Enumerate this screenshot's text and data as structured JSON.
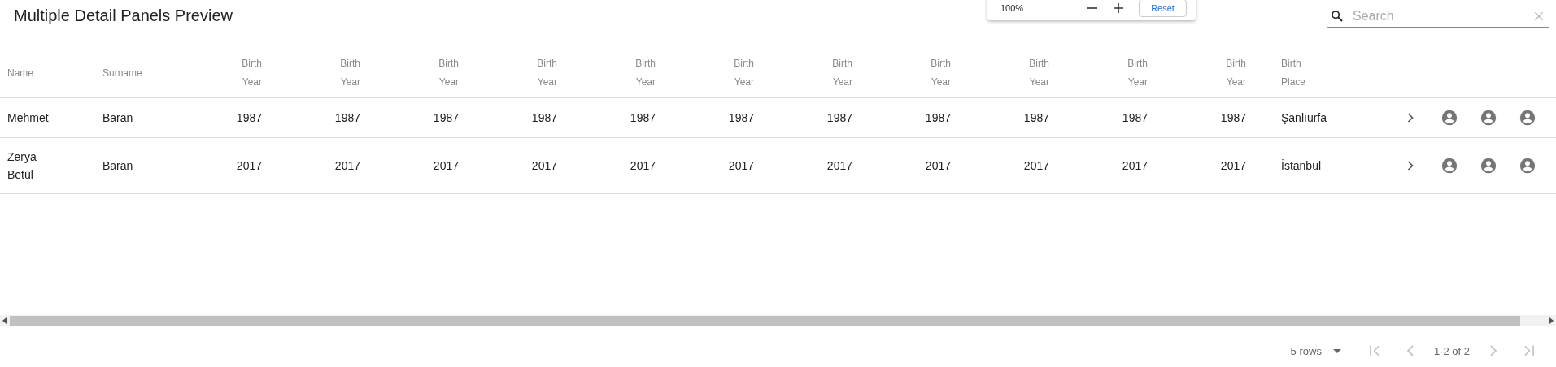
{
  "title": "Multiple Detail Panels Preview",
  "zoom_popup": {
    "level": "100%",
    "reset": "Reset"
  },
  "search": {
    "placeholder": "Search"
  },
  "table": {
    "columns": [
      {
        "label": "Name",
        "kind": "text"
      },
      {
        "label": "Surname",
        "kind": "text"
      },
      {
        "label": "Birth Year",
        "kind": "number"
      },
      {
        "label": "Birth Year",
        "kind": "number"
      },
      {
        "label": "Birth Year",
        "kind": "number"
      },
      {
        "label": "Birth Year",
        "kind": "number"
      },
      {
        "label": "Birth Year",
        "kind": "number"
      },
      {
        "label": "Birth Year",
        "kind": "number"
      },
      {
        "label": "Birth Year",
        "kind": "number"
      },
      {
        "label": "Birth Year",
        "kind": "number"
      },
      {
        "label": "Birth Year",
        "kind": "number"
      },
      {
        "label": "Birth Year",
        "kind": "number"
      },
      {
        "label": "Birth Year",
        "kind": "number"
      },
      {
        "label": "Birth Place",
        "kind": "text"
      }
    ],
    "rows": [
      {
        "cells": [
          "Mehmet",
          "Baran",
          "1987",
          "1987",
          "1987",
          "1987",
          "1987",
          "1987",
          "1987",
          "1987",
          "1987",
          "1987",
          "1987",
          "Şanlıurfa"
        ]
      },
      {
        "cells": [
          "Zerya Betül",
          "Baran",
          "2017",
          "2017",
          "2017",
          "2017",
          "2017",
          "2017",
          "2017",
          "2017",
          "2017",
          "2017",
          "2017",
          "İstanbul"
        ]
      }
    ]
  },
  "pagination": {
    "rows_per_page": "5 rows",
    "range": "1-2 of 2",
    "buttons": [
      {
        "kind": "first",
        "disabled": true
      },
      {
        "kind": "prev",
        "disabled": true
      },
      {
        "kind": "next",
        "disabled": true
      },
      {
        "kind": "last",
        "disabled": true
      }
    ]
  }
}
